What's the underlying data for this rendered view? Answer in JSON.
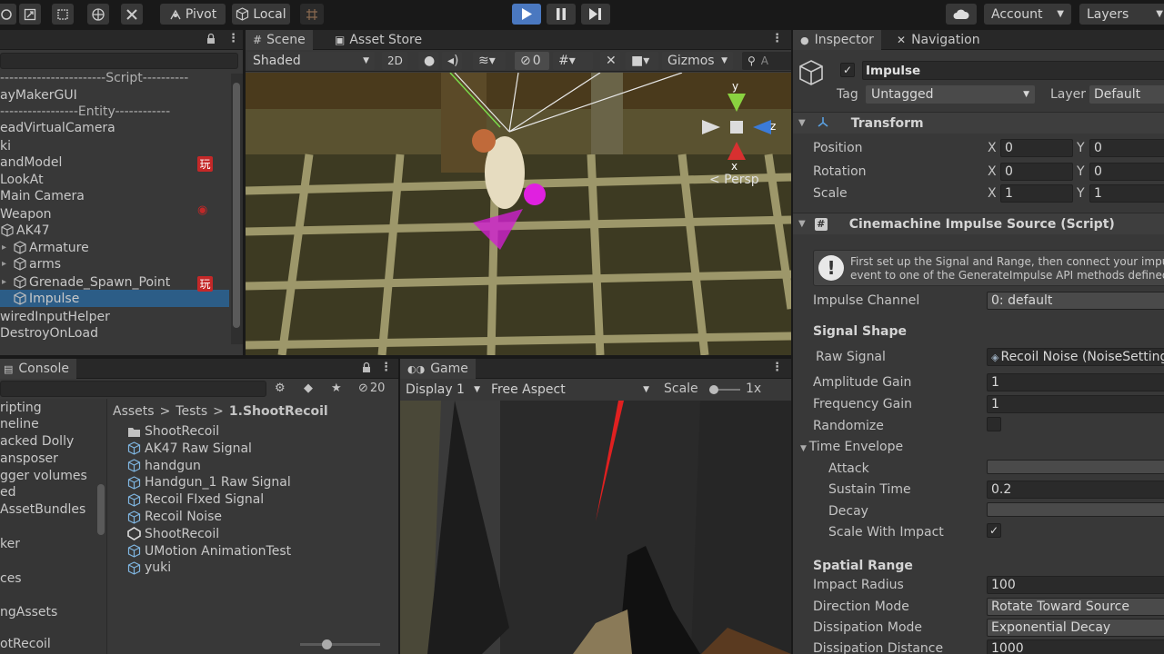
{
  "toolbar": {
    "pivot_label": "Pivot",
    "local_label": "Local",
    "account_label": "Account",
    "layers_label": "Layers"
  },
  "hierarchy": {
    "rows": [
      {
        "label": "-----------------------Script----------",
        "icon": false
      },
      {
        "label": "ayMakerGUI",
        "icon": false
      },
      {
        "label": "-----------------Entity------------",
        "icon": false
      },
      {
        "label": "eadVirtualCamera",
        "icon": false
      },
      {
        "label": "ki",
        "icon": false
      },
      {
        "label": "andModel",
        "icon": false
      },
      {
        "label": "LookAt",
        "icon": false
      },
      {
        "label": "Main Camera",
        "icon": false
      },
      {
        "label": "Weapon",
        "icon": false
      },
      {
        "label": "AK47",
        "icon": true
      },
      {
        "label": "Armature",
        "icon": true
      },
      {
        "label": "arms",
        "icon": true
      },
      {
        "label": "Grenade_Spawn_Point",
        "icon": true
      },
      {
        "label": "Impulse",
        "icon": true
      },
      {
        "label": "wiredInputHelper",
        "icon": false
      },
      {
        "label": "DestroyOnLoad",
        "icon": false
      }
    ],
    "badge_glyph": "玩"
  },
  "scene": {
    "tab_label": "Scene",
    "store_tab_label": "Asset Store",
    "shading_mode": "Shaded",
    "mode_2d": "2D",
    "hidden_count": "0",
    "gizmos_label": "Gizmos",
    "search_placeholder": "A",
    "persp_label": "< Persp",
    "axis_y": "y",
    "axis_z": "z",
    "axis_x": "x"
  },
  "inspector": {
    "tab_label": "Inspector",
    "nav_tab_label": "Navigation",
    "object_name": "Impulse",
    "tag_label": "Tag",
    "tag_value": "Untagged",
    "layer_label": "Layer",
    "layer_value": "Default",
    "transform_title": "Transform",
    "position_label": "Position",
    "rotation_label": "Rotation",
    "scale_label": "Scale",
    "pos_x": "0",
    "pos_y": "0",
    "rot_x": "0",
    "rot_y": "0",
    "scale_x": "1",
    "scale_y": "1",
    "x_label": "X",
    "y_label": "Y",
    "impulse_title": "Cinemachine Impulse Source (Script)",
    "help_line1": "First set up the Signal and Range, then connect your impulse",
    "help_line2": "event to one of the GenerateImpulse API methods defined i",
    "impulse_channel_label": "Impulse Channel",
    "impulse_channel_value": "0: default",
    "signal_shape_header": "Signal Shape",
    "raw_signal_label": "Raw Signal",
    "raw_signal_value": "Recoil Noise (NoiseSetting",
    "amplitude_gain_label": "Amplitude Gain",
    "amplitude_gain_value": "1",
    "frequency_gain_label": "Frequency Gain",
    "frequency_gain_value": "1",
    "randomize_label": "Randomize",
    "time_envelope_label": "Time Envelope",
    "attack_label": "Attack",
    "sustain_label": "Sustain Time",
    "sustain_value": "0.2",
    "decay_label": "Decay",
    "scale_impact_label": "Scale With Impact",
    "spatial_range_header": "Spatial Range",
    "impact_radius_label": "Impact Radius",
    "impact_radius_value": "100",
    "direction_mode_label": "Direction Mode",
    "direction_mode_value": "Rotate Toward Source",
    "dissipation_mode_label": "Dissipation Mode",
    "dissipation_mode_value": "Exponential Decay",
    "dissipation_distance_label": "Dissipation Distance",
    "dissipation_distance_value": "1000"
  },
  "console": {
    "tab_label": "Console",
    "hidden_count": "20",
    "breadcrumb_assets": "Assets",
    "breadcrumb_sep": ">",
    "breadcrumb_tests": "Tests",
    "breadcrumb_current": "1.ShootRecoil",
    "left_items": [
      "ripting",
      "neline",
      "acked Dolly",
      "ansposer",
      "gger volumes",
      "ed",
      "AssetBundles",
      "ker",
      "ces",
      "ngAssets",
      "otRecoil"
    ],
    "assets": [
      {
        "label": "ShootRecoil",
        "icon": "folder-icon"
      },
      {
        "label": "AK47 Raw Signal",
        "icon": "asset-cube-icon"
      },
      {
        "label": "handgun",
        "icon": "asset-cube-icon"
      },
      {
        "label": "Handgun_1 Raw Signal",
        "icon": "asset-cube-icon"
      },
      {
        "label": "Recoil FIxed Signal",
        "icon": "asset-cube-icon"
      },
      {
        "label": "Recoil Noise",
        "icon": "asset-cube-icon"
      },
      {
        "label": "ShootRecoil",
        "icon": "unity-scene-icon"
      },
      {
        "label": "UMotion AnimationTest",
        "icon": "asset-cube-icon"
      },
      {
        "label": "yuki",
        "icon": "asset-cube-icon"
      }
    ]
  },
  "game": {
    "tab_label": "Game",
    "display_label": "Display 1",
    "aspect_label": "Free Aspect",
    "scale_label": "Scale",
    "scale_value": "1x"
  },
  "colors": {
    "selection": "#2c5d87",
    "play_active": "#4a78c0",
    "panel": "#383838"
  }
}
